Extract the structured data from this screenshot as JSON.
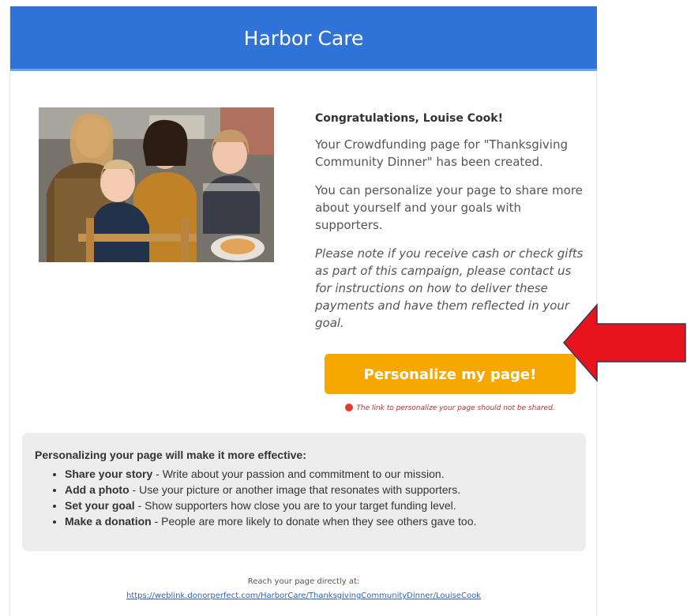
{
  "header": {
    "title": "Harbor Care"
  },
  "content": {
    "greeting": "Congratulations, Louise Cook!",
    "created_message": "Your Crowdfunding page for \"Thanksgiving Community Dinner\" has been created.",
    "personalize_message": "You can personalize your page to share more about yourself and your goals with supporters.",
    "note": "Please note if you receive cash or check gifts as part of this campaign, please contact us for instructions on how to deliver these payments and have them reflected in your goal."
  },
  "cta": {
    "label": "Personalize my page!"
  },
  "warning": {
    "text": "The link to personalize your page should not be shared."
  },
  "tips": {
    "title": "Personalizing your page will make it more effective:",
    "items": [
      {
        "label": "Share your story",
        "text": " - Write about your passion and commitment to our mission."
      },
      {
        "label": "Add a photo",
        "text": " - Use your picture or another image that resonates with supporters."
      },
      {
        "label": "Set your goal",
        "text": " - Show supporters how close you are to your target funding level."
      },
      {
        "label": "Make a donation",
        "text": " - People are more likely to donate when they see others gave too."
      }
    ]
  },
  "footer": {
    "reach_text": "Reach your page directly at:",
    "link": "https://weblink.donorperfect.com/HarborCare/ThanksgivingCommunityDinner/LouiseCook"
  },
  "colors": {
    "header_blue": "#2f72d8",
    "cta_orange": "#f6a800",
    "arrow_red": "#e8141b",
    "warning_red": "#c2302a",
    "tips_bg": "#ededed"
  }
}
